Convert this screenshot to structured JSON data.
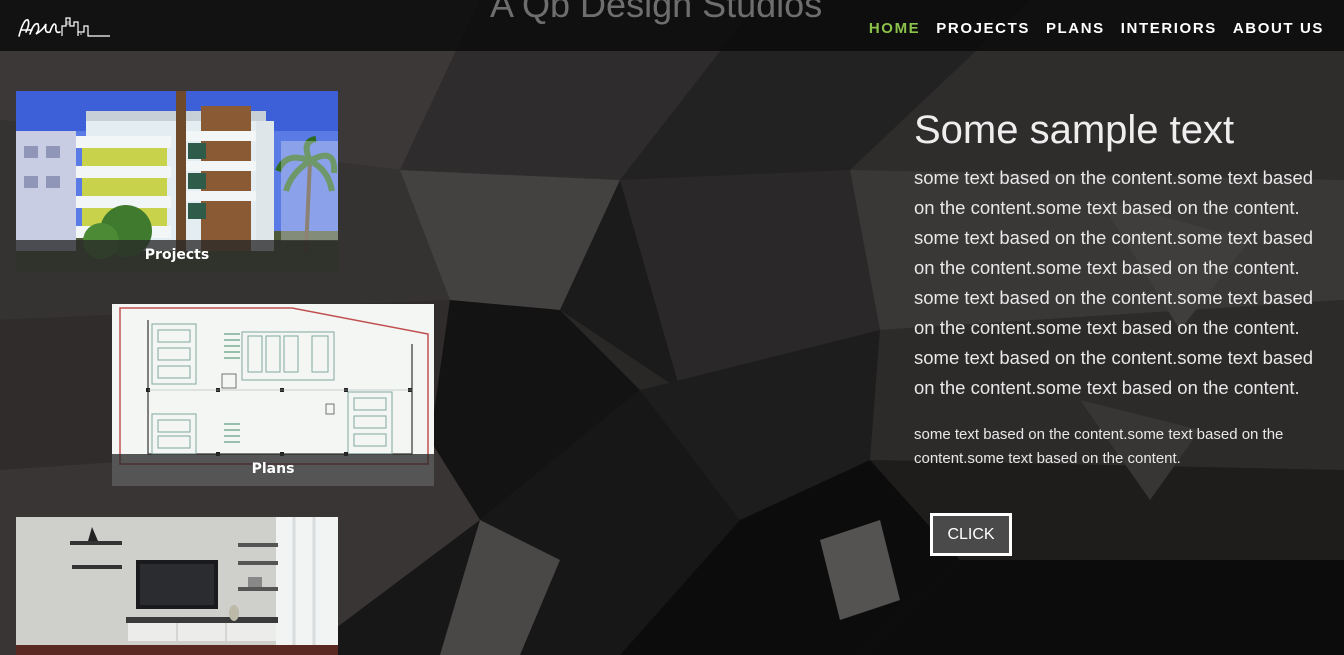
{
  "header": {
    "site_title": "A Qb Design Studios",
    "logo_alt": "AQb",
    "nav": [
      {
        "label": "HOME",
        "active": true
      },
      {
        "label": "PROJECTS",
        "active": false
      },
      {
        "label": "PLANS",
        "active": false
      },
      {
        "label": "INTERIORS",
        "active": false
      },
      {
        "label": "ABOUT US",
        "active": false
      }
    ],
    "active_color": "#8bc34a"
  },
  "cards": {
    "projects_caption": "Projects",
    "plans_caption": "Plans"
  },
  "content": {
    "heading": "Some sample text",
    "paragraph": "some text based on the content.some text based on the content.some text based on the content. some text based on the content.some text based on the content.some text based on the content. some text based on the content.some text based on the content.some text based on the content. some text based on the content.some text based on the content.some text based on the content.",
    "small_paragraph": "some text based on the content.some text based on the content.some text based on the content.",
    "button_label": "CLICK"
  }
}
